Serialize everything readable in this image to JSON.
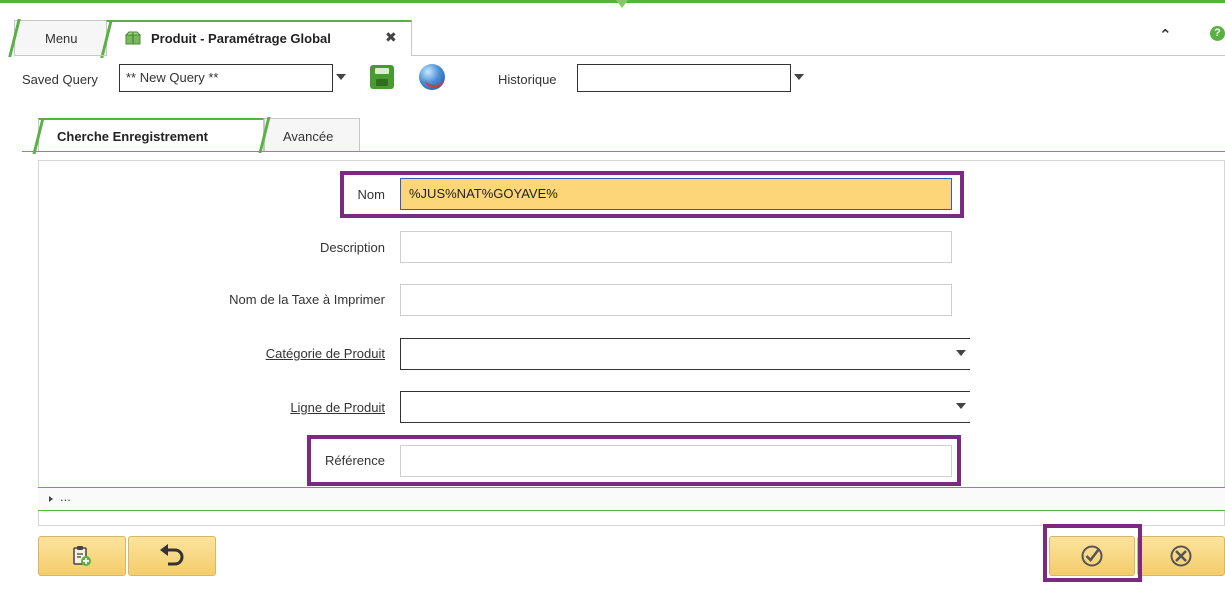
{
  "window_tabs": [
    {
      "label": "Menu"
    },
    {
      "label": "Produit - Paramétrage Global",
      "close": "✖"
    }
  ],
  "toolbar": {
    "saved_query_label": "Saved Query",
    "saved_query_value": "** New Query **",
    "historique_label": "Historique",
    "historique_value": ""
  },
  "search_tabs": [
    {
      "label": "Cherche Enregistrement",
      "active": true
    },
    {
      "label": "Avancée",
      "active": false
    }
  ],
  "form": {
    "fields": [
      {
        "label": "Nom",
        "value": "%JUS%NAT%GOYAVE%"
      },
      {
        "label": "Description",
        "value": ""
      },
      {
        "label": "Nom de la Taxe à Imprimer",
        "value": ""
      },
      {
        "label": "Catégorie de Produit",
        "value": ""
      },
      {
        "label": "Ligne de Produit",
        "value": ""
      },
      {
        "label": "Référence",
        "value": ""
      }
    ]
  },
  "expander": {
    "label": "..."
  },
  "icons": {
    "collapse": "chevrons-up-icon",
    "help": "help-icon",
    "save": "save-icon",
    "globe": "globe-icon",
    "new_record": "new-record-icon",
    "undo": "undo-icon",
    "ok": "check-circle-icon",
    "cancel": "x-circle-icon"
  },
  "colors": {
    "accent_green": "#58b140",
    "highlight_purple": "#7b2a80",
    "active_field": "#fcd679",
    "button_yellow": "#f4cd6b"
  }
}
